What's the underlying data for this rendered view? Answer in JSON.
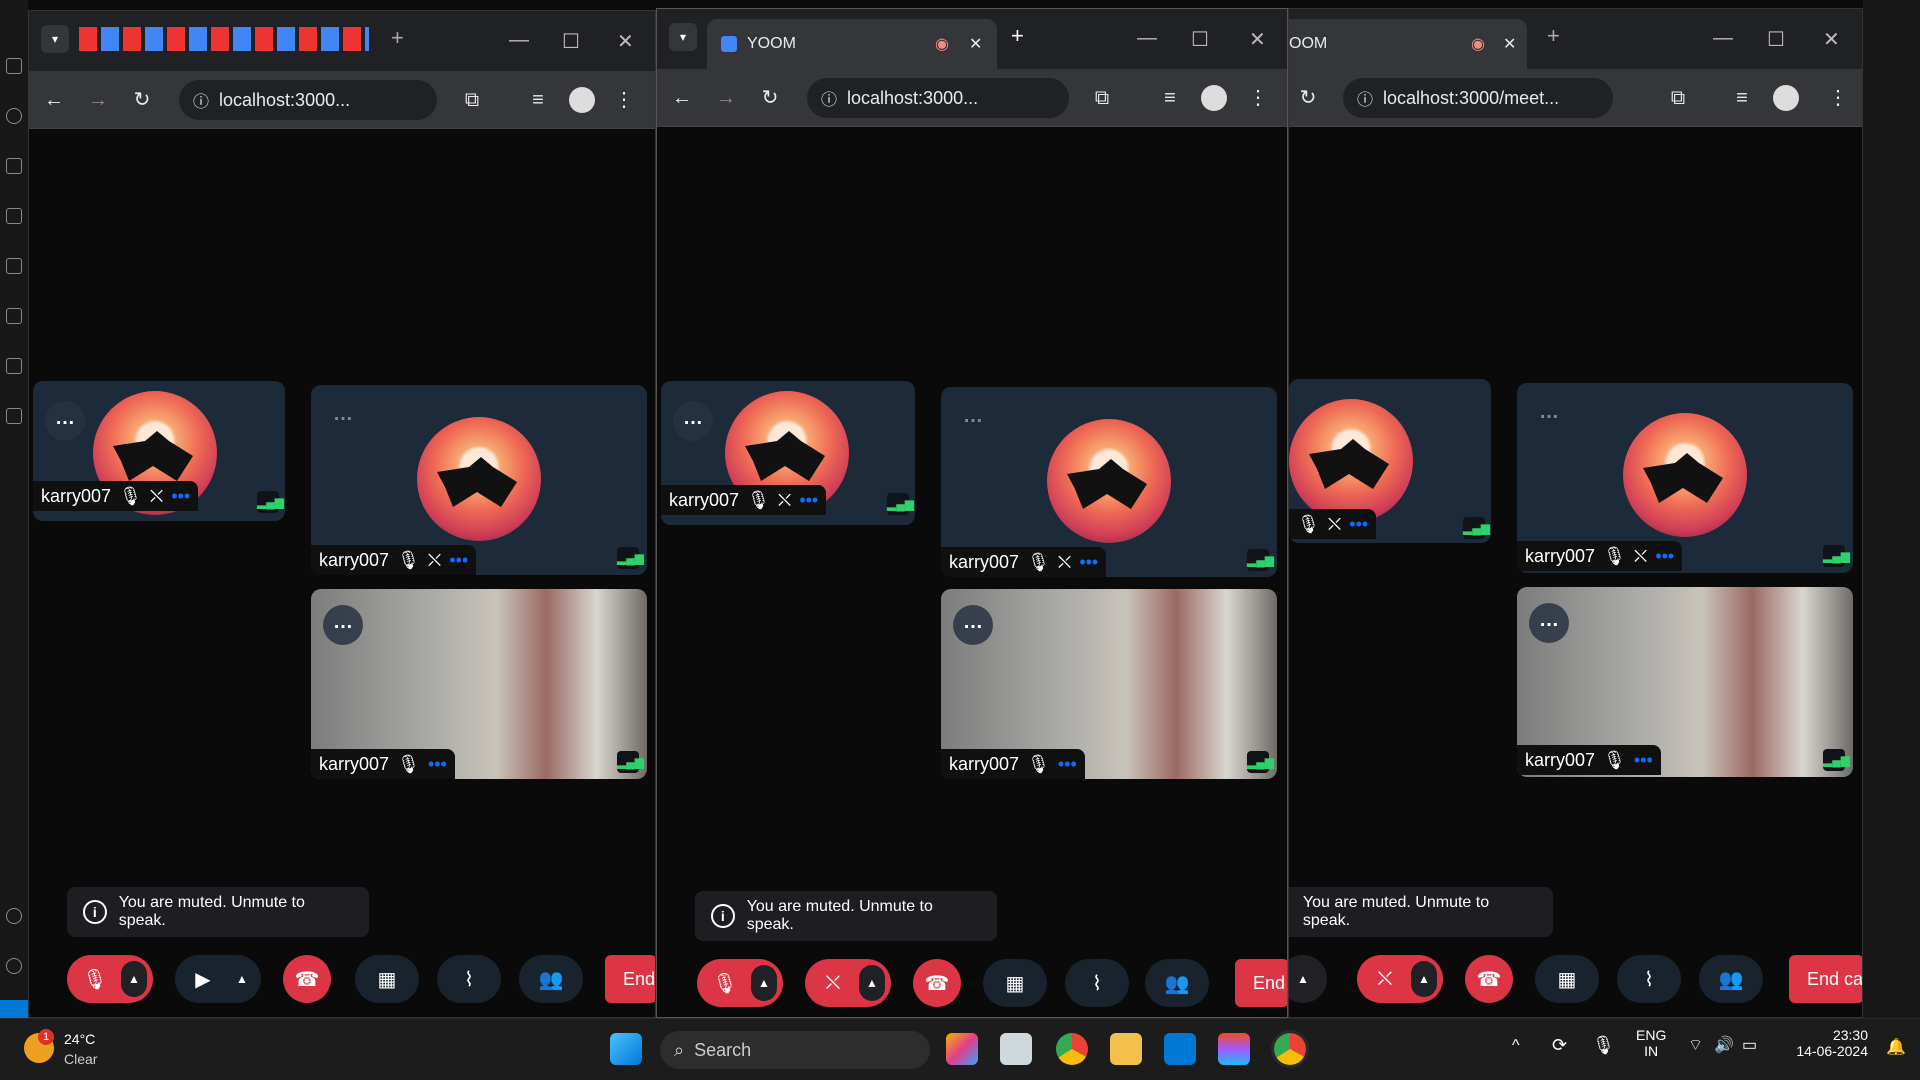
{
  "left_window": {
    "omnibox_text": "localhost:3000...",
    "toolbar": {
      "back": "←",
      "forward": "→",
      "reload": "↻"
    },
    "tiles": [
      {
        "name": "karry007",
        "kind": "avatar"
      },
      {
        "name": "karry007",
        "kind": "avatar"
      },
      {
        "name": "karry007",
        "kind": "video"
      }
    ]
  },
  "middle_window": {
    "tab_title": "YOOM",
    "omnibox_text": "localhost:3000...",
    "tiles": [
      {
        "name": "karry007",
        "kind": "avatar"
      },
      {
        "name": "karry007",
        "kind": "avatar"
      },
      {
        "name": "karry007",
        "kind": "video"
      }
    ]
  },
  "right_window": {
    "tab_title": "OOM",
    "omnibox_text": "localhost:3000/meet...",
    "tiles": [
      {
        "name": "karry007",
        "kind": "avatar"
      },
      {
        "name": "karry007",
        "kind": "video"
      }
    ]
  },
  "toast": {
    "message": "You are muted. Unmute to speak."
  },
  "controls": {
    "end_left": "End",
    "end_middle": "End",
    "end_right": "End ca"
  },
  "taskbar": {
    "weather_temp": "24°C",
    "weather_desc": "Clear",
    "weather_badge": "1",
    "search_label": "Search",
    "lang_line1": "ENG",
    "lang_line2": "IN",
    "time": "23:30",
    "date": "14-06-2024"
  },
  "colors": {
    "accent_red": "#dc3545",
    "tile_bg": "#1c2a3a",
    "signal_green": "#2fd16b"
  }
}
